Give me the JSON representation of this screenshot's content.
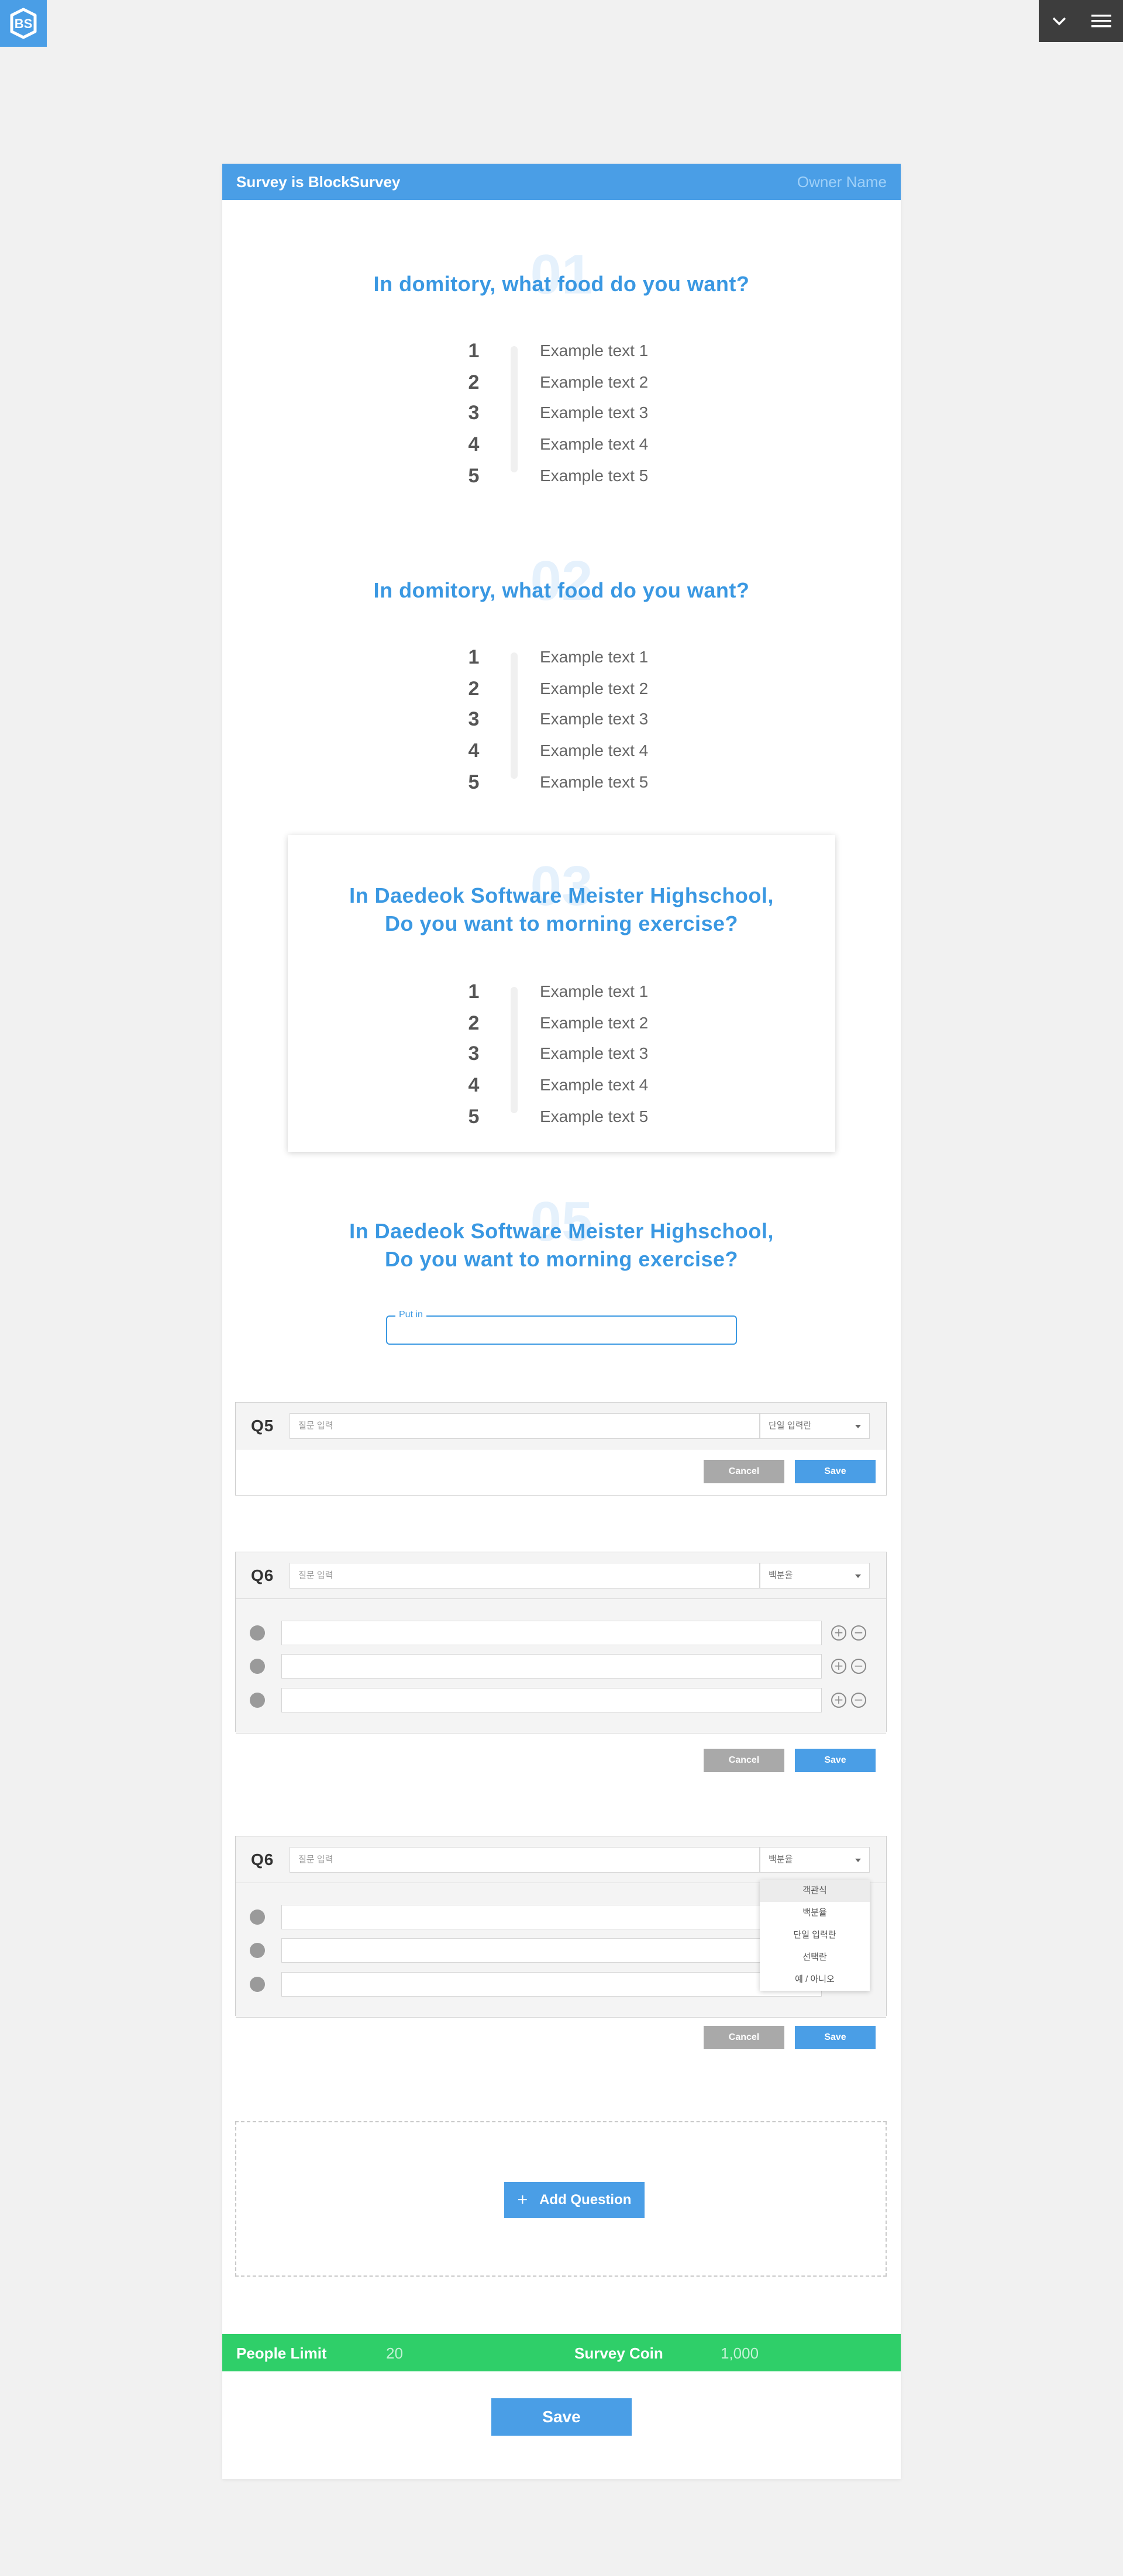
{
  "header": {
    "logo_text": "BS",
    "menu_toggle_icon": "chevron-down-icon",
    "menu_icon": "hamburger-icon"
  },
  "survey": {
    "title": "Survey is BlockSurvey",
    "owner": "Owner Name"
  },
  "questions": [
    {
      "number": "01",
      "title": "In domitory, what food do you want?",
      "options": [
        {
          "n": "1",
          "text": "Example text 1"
        },
        {
          "n": "2",
          "text": "Example text 2"
        },
        {
          "n": "3",
          "text": "Example text 3"
        },
        {
          "n": "4",
          "text": "Example text 4"
        },
        {
          "n": "5",
          "text": "Example text 5"
        }
      ]
    },
    {
      "number": "02",
      "title": "In domitory, what food do you want?",
      "options": [
        {
          "n": "1",
          "text": "Example text 1"
        },
        {
          "n": "2",
          "text": "Example text 2"
        },
        {
          "n": "3",
          "text": "Example text 3"
        },
        {
          "n": "4",
          "text": "Example text 4"
        },
        {
          "n": "5",
          "text": "Example text 5"
        }
      ]
    },
    {
      "number": "03",
      "title_line1": "In Daedeok Software Meister Highschool,",
      "title_line2": "Do you want to morning exercise?",
      "options": [
        {
          "n": "1",
          "text": "Example text 1"
        },
        {
          "n": "2",
          "text": "Example text 2"
        },
        {
          "n": "3",
          "text": "Example text 3"
        },
        {
          "n": "4",
          "text": "Example text 4"
        },
        {
          "n": "5",
          "text": "Example text 5"
        }
      ]
    },
    {
      "number": "05",
      "title_line1": "In Daedeok Software Meister Highschool,",
      "title_line2": "Do you want to morning exercise?",
      "input_label": "Put in",
      "input_value": ""
    }
  ],
  "editors": [
    {
      "label": "Q5",
      "question_placeholder": "질문 입력",
      "type_value": "단일 입력란",
      "cancel_label": "Cancel",
      "save_label": "Save"
    },
    {
      "label": "Q6",
      "question_placeholder": "질문 입력",
      "type_value": "백분율",
      "add_icon": "plus-circle-icon",
      "remove_icon": "minus-circle-icon",
      "cancel_label": "Cancel",
      "save_label": "Save"
    },
    {
      "label": "Q6",
      "question_placeholder": "질문 입력",
      "type_value": "백분율",
      "dropdown_options": [
        "객관식",
        "백분율",
        "단일 입력란",
        "선택란",
        "예 / 아니오"
      ],
      "dropdown_selected": "객관식",
      "cancel_label": "Cancel",
      "save_label": "Save"
    }
  ],
  "add_question": {
    "label": "Add Question",
    "icon": "plus-icon"
  },
  "footer": {
    "people_limit_label": "People Limit",
    "people_limit_value": "20",
    "survey_coin_label": "Survey Coin",
    "survey_coin_value": "1,000",
    "save_label": "Save"
  },
  "colors": {
    "primary": "#4a9ee6",
    "title_blue": "#3a98e2",
    "green": "#2fcf69",
    "cancel_gray": "#a9a9a9",
    "dark": "#3d3d3d"
  }
}
